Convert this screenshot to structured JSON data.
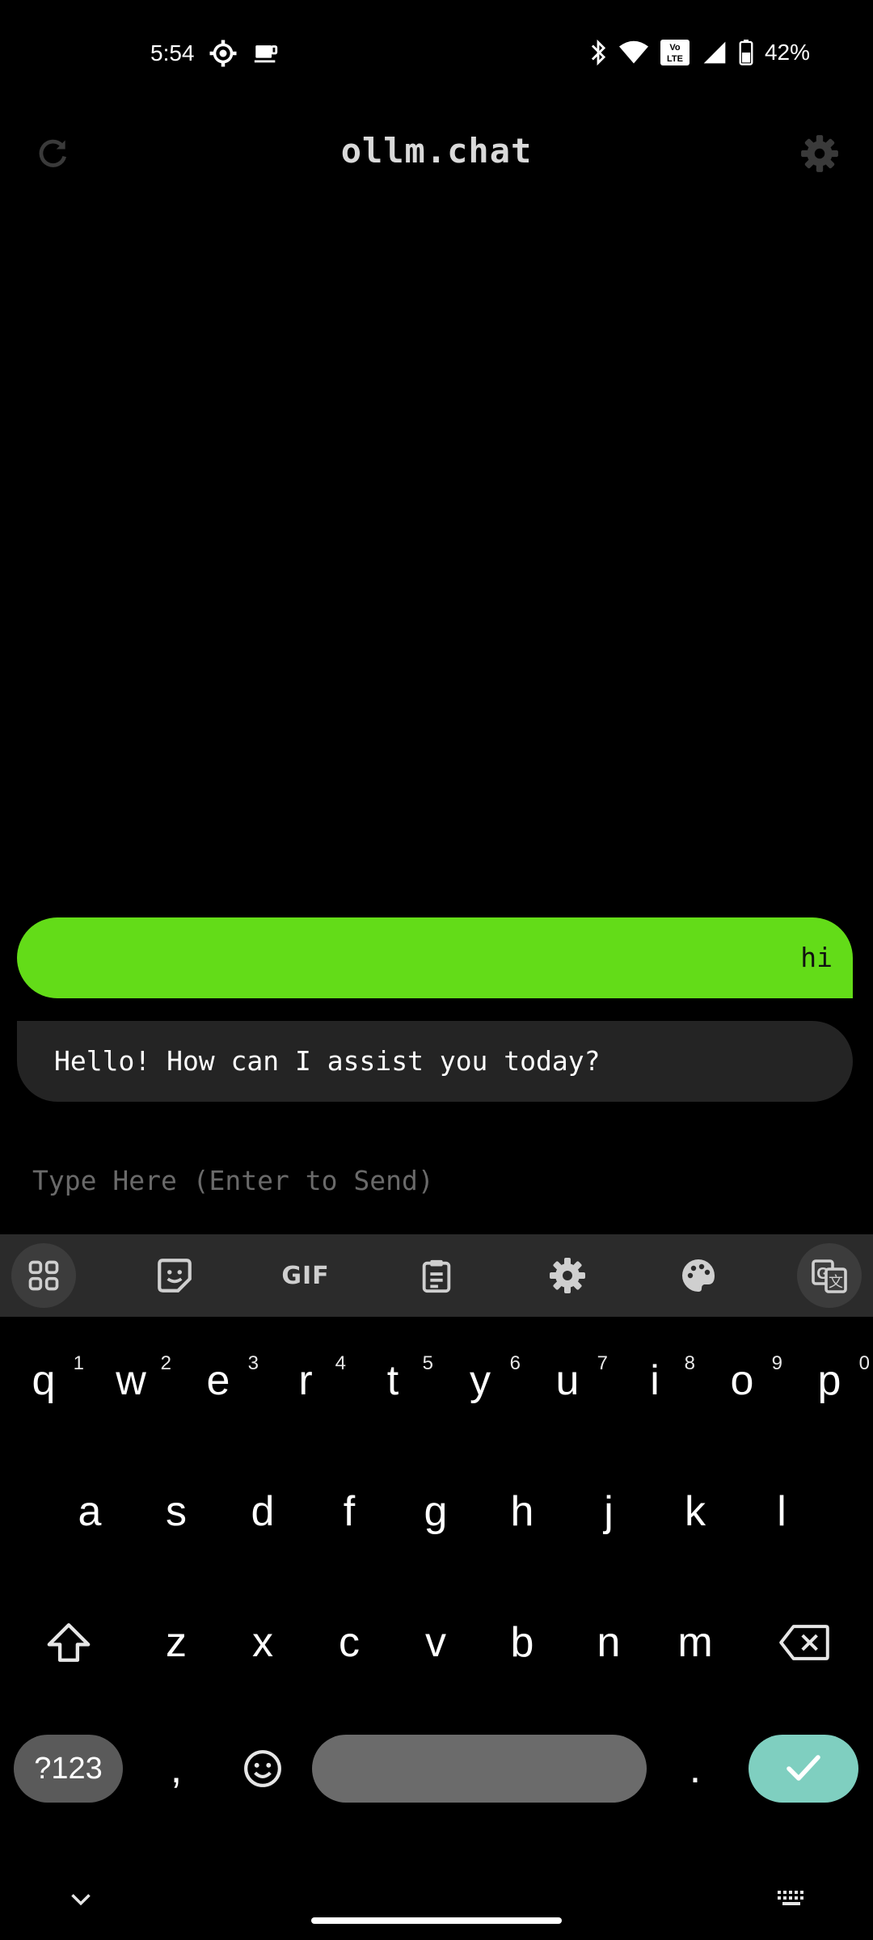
{
  "status_bar": {
    "time": "5:54",
    "battery_percent": "42%",
    "icons_left": [
      "settings-gear-status-icon",
      "coffee-cup-icon"
    ],
    "icons_right": [
      "bluetooth-icon",
      "wifi-icon",
      "volte-icon",
      "cellular-signal-icon",
      "battery-icon"
    ],
    "volte_label": "Vo LTE"
  },
  "app_bar": {
    "title": "ollm.chat",
    "left_icon": "refresh-icon",
    "right_icon": "gear-icon"
  },
  "messages": [
    {
      "role": "user",
      "text": "hi"
    },
    {
      "role": "assistant",
      "text": "Hello! How can I assist you today?"
    }
  ],
  "input": {
    "placeholder": "Type Here (Enter to Send)",
    "value": ""
  },
  "keyboard": {
    "toolbar": [
      "apps-grid-icon",
      "sticker-icon",
      "GIF",
      "clipboard-icon",
      "gear-icon",
      "palette-icon",
      "translate-icon"
    ],
    "gif_label": "GIF",
    "row1": [
      {
        "k": "q",
        "h": "1"
      },
      {
        "k": "w",
        "h": "2"
      },
      {
        "k": "e",
        "h": "3"
      },
      {
        "k": "r",
        "h": "4"
      },
      {
        "k": "t",
        "h": "5"
      },
      {
        "k": "y",
        "h": "6"
      },
      {
        "k": "u",
        "h": "7"
      },
      {
        "k": "i",
        "h": "8"
      },
      {
        "k": "o",
        "h": "9"
      },
      {
        "k": "p",
        "h": "0"
      }
    ],
    "row2": [
      "a",
      "s",
      "d",
      "f",
      "g",
      "h",
      "j",
      "k",
      "l"
    ],
    "row3": [
      "z",
      "x",
      "c",
      "v",
      "b",
      "n",
      "m"
    ],
    "mode_label": "?123",
    "comma": ",",
    "period": ".",
    "accent_color": "#63dc18",
    "enter_color": "#7fcfc0"
  }
}
